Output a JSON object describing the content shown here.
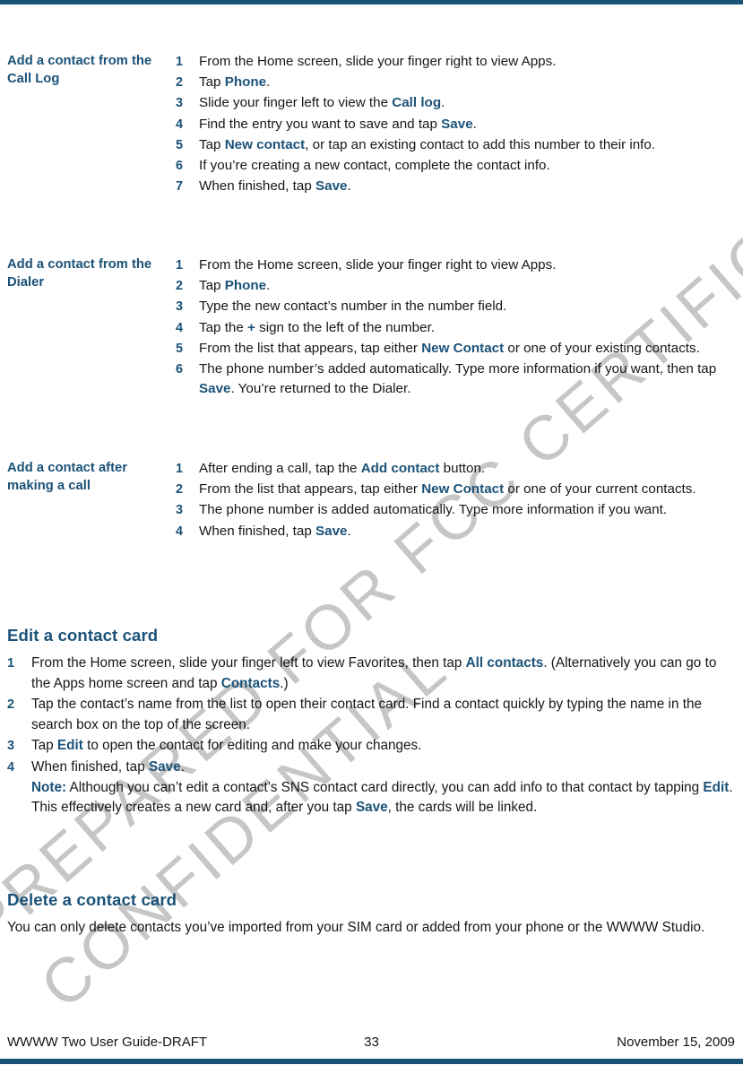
{
  "page": {
    "rule_color": "#1b5278",
    "accent_color": "#1b5278",
    "body_color": "#171717",
    "watermark_color": "#c6c6c6"
  },
  "watermark": {
    "line1": "PREPARED FOR FCC CERTIFICATION",
    "line2": "CONFIDENTIAL"
  },
  "procedures": [
    {
      "label": "Add a contact from the Call Log",
      "steps": [
        {
          "num": "1",
          "parts": [
            {
              "t": "From the Home screen, slide your finger right to view Apps.",
              "kw": false
            }
          ]
        },
        {
          "num": "2",
          "parts": [
            {
              "t": "Tap ",
              "kw": false
            },
            {
              "t": "Phone",
              "kw": true
            },
            {
              "t": ".",
              "kw": false
            }
          ]
        },
        {
          "num": "3",
          "parts": [
            {
              "t": "Slide your finger left to view the ",
              "kw": false
            },
            {
              "t": "Call log",
              "kw": true
            },
            {
              "t": ".",
              "kw": false
            }
          ]
        },
        {
          "num": "4",
          "parts": [
            {
              "t": "Find the entry you want to save and tap ",
              "kw": false
            },
            {
              "t": "Save",
              "kw": true
            },
            {
              "t": ".",
              "kw": false
            }
          ]
        },
        {
          "num": "5",
          "parts": [
            {
              "t": "Tap ",
              "kw": false
            },
            {
              "t": "New contact",
              "kw": true
            },
            {
              "t": ", or tap an existing contact to add this number to their info.",
              "kw": false
            }
          ]
        },
        {
          "num": "6",
          "parts": [
            {
              "t": "If you’re creating a new contact, complete the contact info.",
              "kw": false
            }
          ]
        },
        {
          "num": "7",
          "parts": [
            {
              "t": "When finished, tap ",
              "kw": false
            },
            {
              "t": "Save",
              "kw": true
            },
            {
              "t": ".",
              "kw": false
            }
          ]
        }
      ]
    },
    {
      "label": "Add a contact from the Dialer",
      "steps": [
        {
          "num": "1",
          "parts": [
            {
              "t": "From the Home screen, slide your finger right to view Apps.",
              "kw": false
            }
          ]
        },
        {
          "num": "2",
          "parts": [
            {
              "t": "Tap ",
              "kw": false
            },
            {
              "t": "Phone",
              "kw": true
            },
            {
              "t": ".",
              "kw": false
            }
          ]
        },
        {
          "num": "3",
          "parts": [
            {
              "t": "Type the new contact’s number in the number field.",
              "kw": false
            }
          ]
        },
        {
          "num": "4",
          "parts": [
            {
              "t": "Tap the ",
              "kw": false
            },
            {
              "t": "+",
              "kw": true
            },
            {
              "t": " sign to the left of the number.",
              "kw": false
            }
          ]
        },
        {
          "num": "5",
          "parts": [
            {
              "t": "From the list that appears, tap either ",
              "kw": false
            },
            {
              "t": "New Contact",
              "kw": true
            },
            {
              "t": " or one of your existing contacts.",
              "kw": false
            }
          ]
        },
        {
          "num": "6",
          "parts": [
            {
              "t": "The phone number’s added automatically. Type more information if you want, then tap ",
              "kw": false
            },
            {
              "t": "Save",
              "kw": true
            },
            {
              "t": ". You’re returned to the Dialer.",
              "kw": false
            }
          ]
        }
      ]
    },
    {
      "label": "Add a contact after making a call",
      "steps": [
        {
          "num": "1",
          "parts": [
            {
              "t": "After ending a call, tap the ",
              "kw": false
            },
            {
              "t": "Add contact",
              "kw": true
            },
            {
              "t": " button.",
              "kw": false
            }
          ]
        },
        {
          "num": "2",
          "parts": [
            {
              "t": "From the list that appears, tap either ",
              "kw": false
            },
            {
              "t": "New Contact",
              "kw": true
            },
            {
              "t": " or one of your current contacts.",
              "kw": false
            }
          ]
        },
        {
          "num": "3",
          "parts": [
            {
              "t": "The phone number is added automatically. Type more information if you want.",
              "kw": false
            }
          ]
        },
        {
          "num": "4",
          "parts": [
            {
              "t": "When finished, tap ",
              "kw": false
            },
            {
              "t": "Save",
              "kw": true
            },
            {
              "t": ".",
              "kw": false
            }
          ]
        }
      ]
    }
  ],
  "edit_section": {
    "title": "Edit a contact card",
    "steps": [
      {
        "num": "1",
        "parts": [
          {
            "t": "From the Home screen, slide your finger left to view Favorites, then tap ",
            "kw": false
          },
          {
            "t": "All contacts",
            "kw": true
          },
          {
            "t": ". (Alternatively you can go to the Apps home screen and tap ",
            "kw": false
          },
          {
            "t": "Contacts",
            "kw": true
          },
          {
            "t": ".)",
            "kw": false
          }
        ]
      },
      {
        "num": "2",
        "parts": [
          {
            "t": "Tap the contact’s name from the list to open their contact card. Find a contact quickly by typing the name in the search box on the top of the screen.",
            "kw": false
          }
        ]
      },
      {
        "num": "3",
        "parts": [
          {
            "t": "Tap ",
            "kw": false
          },
          {
            "t": "Edit",
            "kw": true
          },
          {
            "t": " to open the contact for editing and make your changes.",
            "kw": false
          }
        ]
      },
      {
        "num": "4",
        "parts": [
          {
            "t": "When finished, tap ",
            "kw": false
          },
          {
            "t": "Save",
            "kw": true
          },
          {
            "t": ".",
            "kw": false
          }
        ],
        "note": [
          {
            "t": "Note:",
            "kw": true
          },
          {
            "t": " Although you can’t edit a contact’s SNS contact card directly, you can add info to that contact by tapping ",
            "kw": false
          },
          {
            "t": "Edit",
            "kw": true
          },
          {
            "t": ". This effectively creates a new card and, after you tap ",
            "kw": false
          },
          {
            "t": "Save",
            "kw": true
          },
          {
            "t": ", the cards will be linked.",
            "kw": false
          }
        ]
      }
    ]
  },
  "delete_section": {
    "title": "Delete a contact card",
    "body": "You can only delete contacts you’ve imported from your SIM card or added from your phone or the WWWW Studio."
  },
  "footer": {
    "left": "WWWW Two User Guide-DRAFT",
    "page_number": "33",
    "right": "November 15, 2009"
  }
}
